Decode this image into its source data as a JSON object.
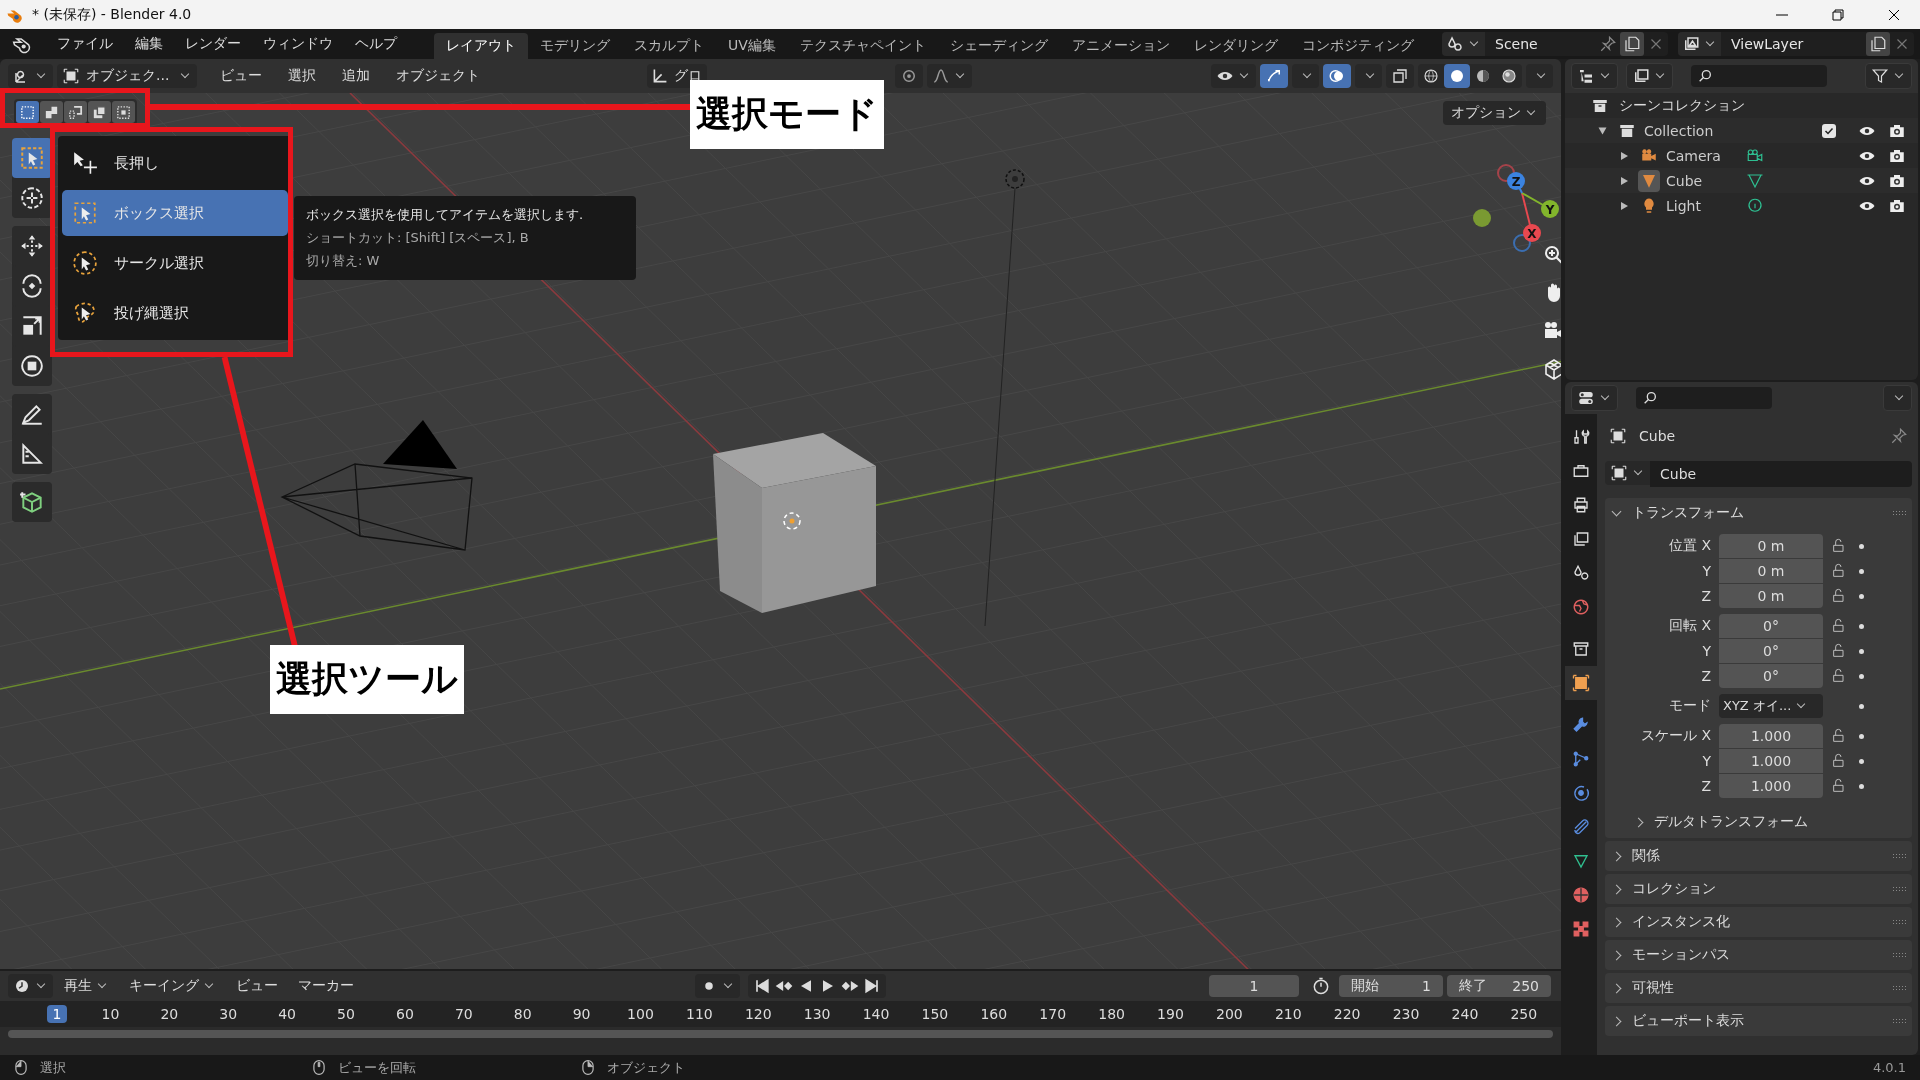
{
  "window": {
    "title": "* (未保存) - Blender 4.0"
  },
  "menu": [
    "ファイル",
    "編集",
    "レンダー",
    "ウィンドウ",
    "ヘルプ"
  ],
  "workspaces": [
    {
      "label": "レイアウト",
      "selected": true
    },
    {
      "label": "モデリング",
      "selected": false
    },
    {
      "label": "スカルプト",
      "selected": false
    },
    {
      "label": "UV編集",
      "selected": false
    },
    {
      "label": "テクスチャペイント",
      "selected": false
    },
    {
      "label": "シェーディング",
      "selected": false
    },
    {
      "label": "アニメーション",
      "selected": false
    },
    {
      "label": "レンダリング",
      "selected": false
    },
    {
      "label": "コンポジティング",
      "selected": false
    }
  ],
  "scene": {
    "name": "Scene"
  },
  "view_layer": {
    "name": "ViewLayer"
  },
  "viewport_header": {
    "mode": "オブジェク...",
    "menus": [
      "ビュー",
      "選択",
      "追加",
      "オブジェクト"
    ],
    "orientation": "グロ",
    "shading": [
      {
        "kind": "wireframe",
        "selected": false
      },
      {
        "kind": "solid",
        "selected": true
      },
      {
        "kind": "material",
        "selected": false
      },
      {
        "kind": "rendered",
        "selected": false
      }
    ]
  },
  "select_modes": [
    {
      "kind": "new",
      "selected": true
    },
    {
      "kind": "extend",
      "selected": false
    },
    {
      "kind": "subtract",
      "selected": false
    },
    {
      "kind": "invert",
      "selected": false
    },
    {
      "kind": "intersect",
      "selected": false
    }
  ],
  "options_button": "オプション",
  "tool_groups": [
    {
      "tools": [
        {
          "kind": "select",
          "selected": true
        },
        {
          "kind": "cursor",
          "selected": false
        }
      ]
    },
    {
      "tools": [
        {
          "kind": "move",
          "selected": false
        },
        {
          "kind": "rotate",
          "selected": false
        },
        {
          "kind": "scale",
          "selected": false
        },
        {
          "kind": "transform",
          "selected": false
        }
      ]
    },
    {
      "tools": [
        {
          "kind": "annotate",
          "selected": false
        },
        {
          "kind": "measure",
          "selected": false
        }
      ]
    },
    {
      "tools": [
        {
          "kind": "add_cube",
          "selected": false
        }
      ]
    }
  ],
  "tool_popup": {
    "hint": "長押し",
    "items": [
      {
        "label": "ボックス選択",
        "kind": "box",
        "selected": true
      },
      {
        "label": "サークル選択",
        "kind": "circle",
        "selected": false
      },
      {
        "label": "投げ縄選択",
        "kind": "lasso",
        "selected": false
      }
    ]
  },
  "tooltip": {
    "lines": [
      "ボックス選択を使用してアイテムを選択します.",
      "ショートカット: [Shift] [スペース], B",
      "切り替え: W"
    ]
  },
  "gizmo": {
    "axes": [
      "X",
      "Y",
      "Z"
    ]
  },
  "annotations": [
    {
      "label": "選択モード"
    },
    {
      "label": "選択ツール"
    }
  ],
  "outliner": {
    "root": "シーンコレクション",
    "collections": [
      {
        "name": "Collection",
        "expanded": true,
        "checked": true,
        "children": [
          {
            "name": "Camera",
            "kind": "camera",
            "active": false
          },
          {
            "name": "Cube",
            "kind": "mesh",
            "active": true
          },
          {
            "name": "Light",
            "kind": "light",
            "active": false
          }
        ]
      }
    ]
  },
  "properties": {
    "tabs": [
      {
        "kind": "tool",
        "selected": false
      },
      {
        "kind": "render",
        "selected": false
      },
      {
        "kind": "output",
        "selected": false
      },
      {
        "kind": "view_layer",
        "selected": false
      },
      {
        "kind": "scene",
        "selected": false
      },
      {
        "kind": "world",
        "selected": false
      },
      {
        "kind": "collection",
        "selected": false
      },
      {
        "kind": "object",
        "selected": true
      },
      {
        "kind": "modifier",
        "selected": false
      },
      {
        "kind": "particles",
        "selected": false
      },
      {
        "kind": "physics",
        "selected": false
      },
      {
        "kind": "constraints",
        "selected": false
      },
      {
        "kind": "data",
        "selected": false
      },
      {
        "kind": "material",
        "selected": false
      },
      {
        "kind": "texture",
        "selected": false
      }
    ],
    "object": "Cube",
    "name_field": "Cube",
    "transform": {
      "title": "トランスフォーム",
      "expanded": true,
      "groups": [
        {
          "rows": [
            {
              "kind": "field",
              "label": "位置 X",
              "value": "0 m"
            },
            {
              "kind": "field",
              "label": "Y",
              "value": "0 m"
            },
            {
              "kind": "field",
              "label": "Z",
              "value": "0 m"
            }
          ]
        },
        {
          "rows": [
            {
              "kind": "field",
              "label": "回転 X",
              "value": "0°"
            },
            {
              "kind": "field",
              "label": "Y",
              "value": "0°"
            },
            {
              "kind": "field",
              "label": "Z",
              "value": "0°"
            }
          ]
        },
        {
          "rows": [
            {
              "kind": "dropdown",
              "label": "モード",
              "value": "XYZ オイ..."
            }
          ]
        },
        {
          "rows": [
            {
              "kind": "field",
              "label": "スケール X",
              "value": "1.000"
            },
            {
              "kind": "field",
              "label": "Y",
              "value": "1.000"
            },
            {
              "kind": "field",
              "label": "Z",
              "value": "1.000"
            }
          ]
        }
      ],
      "subpanel": "デルタトランスフォーム"
    },
    "panels": [
      "関係",
      "コレクション",
      "インスタンス化",
      "モーションパス",
      "可視性",
      "ビューポート表示"
    ]
  },
  "timeline": {
    "menus": [
      "再生",
      "キーイング",
      "ビュー",
      "マーカー"
    ],
    "current_frame": "1",
    "start_label": "開始",
    "start": "1",
    "end_label": "終了",
    "end": "250",
    "ticks": [
      {
        "label": "1",
        "selected": true
      },
      {
        "label": "10",
        "selected": false
      },
      {
        "label": "20",
        "selected": false
      },
      {
        "label": "30",
        "selected": false
      },
      {
        "label": "40",
        "selected": false
      },
      {
        "label": "50",
        "selected": false
      },
      {
        "label": "60",
        "selected": false
      },
      {
        "label": "70",
        "selected": false
      },
      {
        "label": "80",
        "selected": false
      },
      {
        "label": "90",
        "selected": false
      },
      {
        "label": "100",
        "selected": false
      },
      {
        "label": "110",
        "selected": false
      },
      {
        "label": "120",
        "selected": false
      },
      {
        "label": "130",
        "selected": false
      },
      {
        "label": "140",
        "selected": false
      },
      {
        "label": "150",
        "selected": false
      },
      {
        "label": "160",
        "selected": false
      },
      {
        "label": "170",
        "selected": false
      },
      {
        "label": "180",
        "selected": false
      },
      {
        "label": "190",
        "selected": false
      },
      {
        "label": "200",
        "selected": false
      },
      {
        "label": "210",
        "selected": false
      },
      {
        "label": "220",
        "selected": false
      },
      {
        "label": "230",
        "selected": false
      },
      {
        "label": "240",
        "selected": false
      },
      {
        "label": "250",
        "selected": false
      }
    ]
  },
  "status_bar": {
    "items": [
      "選択",
      "ビューを回転",
      "オブジェクト"
    ],
    "version": "4.0.1"
  }
}
